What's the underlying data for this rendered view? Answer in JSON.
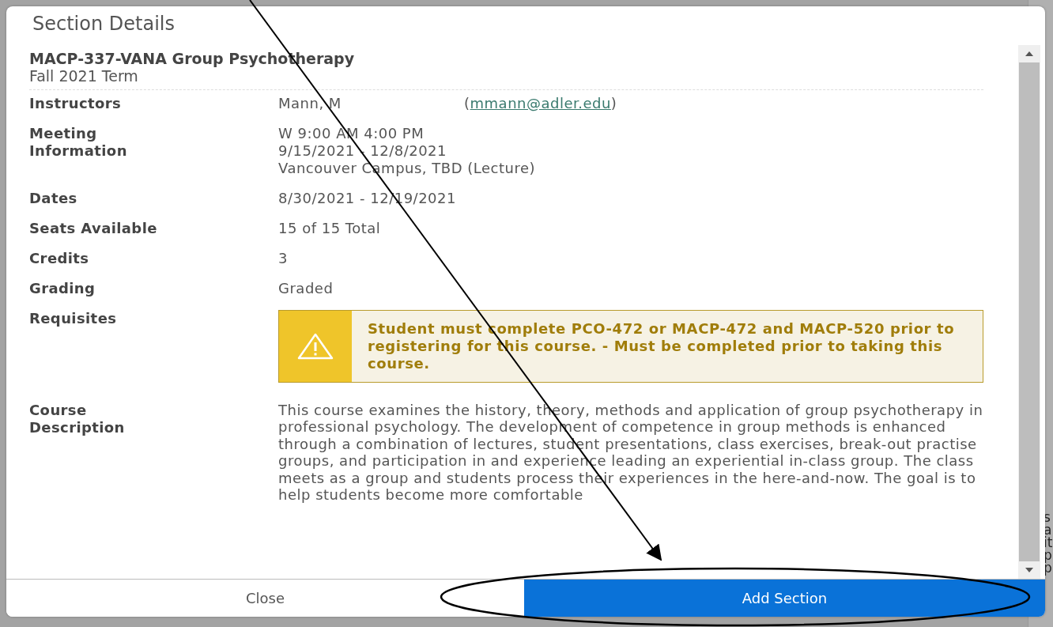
{
  "background": {
    "edge_fragments": [
      "s",
      "a",
      "it",
      "p",
      "p"
    ]
  },
  "dialog": {
    "title": "Section Details",
    "course": "MACP-337-VANA Group Psychotherapy",
    "term": "Fall 2021 Term",
    "details": [
      {
        "kind": "instructor",
        "label": "Instructors",
        "name": "Mann, M",
        "open": "(",
        "email": "mmann@adler.edu",
        "close": ")"
      },
      {
        "kind": "lines",
        "label": "Meeting Information",
        "lines": [
          "W 9:00 AM 4:00 PM",
          "9/15/2021 - 12/8/2021",
          "Vancouver Campus, TBD (Lecture)"
        ]
      },
      {
        "kind": "text",
        "label": "Dates",
        "value": "8/30/2021 - 12/19/2021"
      },
      {
        "kind": "text",
        "label": "Seats Available",
        "value": "15 of 15 Total"
      },
      {
        "kind": "text",
        "label": "Credits",
        "value": "3"
      },
      {
        "kind": "text",
        "label": "Grading",
        "value": "Graded"
      },
      {
        "kind": "warning",
        "label": "Requisites",
        "value": "Student must complete PCO-472 or MACP-472 and MACP-520 prior to registering for this course. - Must be completed prior to taking this course."
      },
      {
        "kind": "paragraph",
        "label": "Course Description",
        "value": "This course examines the history, theory, methods and application of group psychotherapy in professional psychology. The development of competence in group methods is enhanced through a combination of lectures, student presentations, class exercises, break-out practise groups, and participation in and experience leading an experiential in-class group. The class meets as a group and students process their experiences in the here-and-now. The goal is to help students become more comfortable"
      }
    ],
    "buttons": [
      {
        "kind": "secondary",
        "label": "Close"
      },
      {
        "kind": "primary",
        "label": "Add Section"
      }
    ]
  },
  "annotations": {
    "arrow_shown": true,
    "ellipse_shown": true
  }
}
